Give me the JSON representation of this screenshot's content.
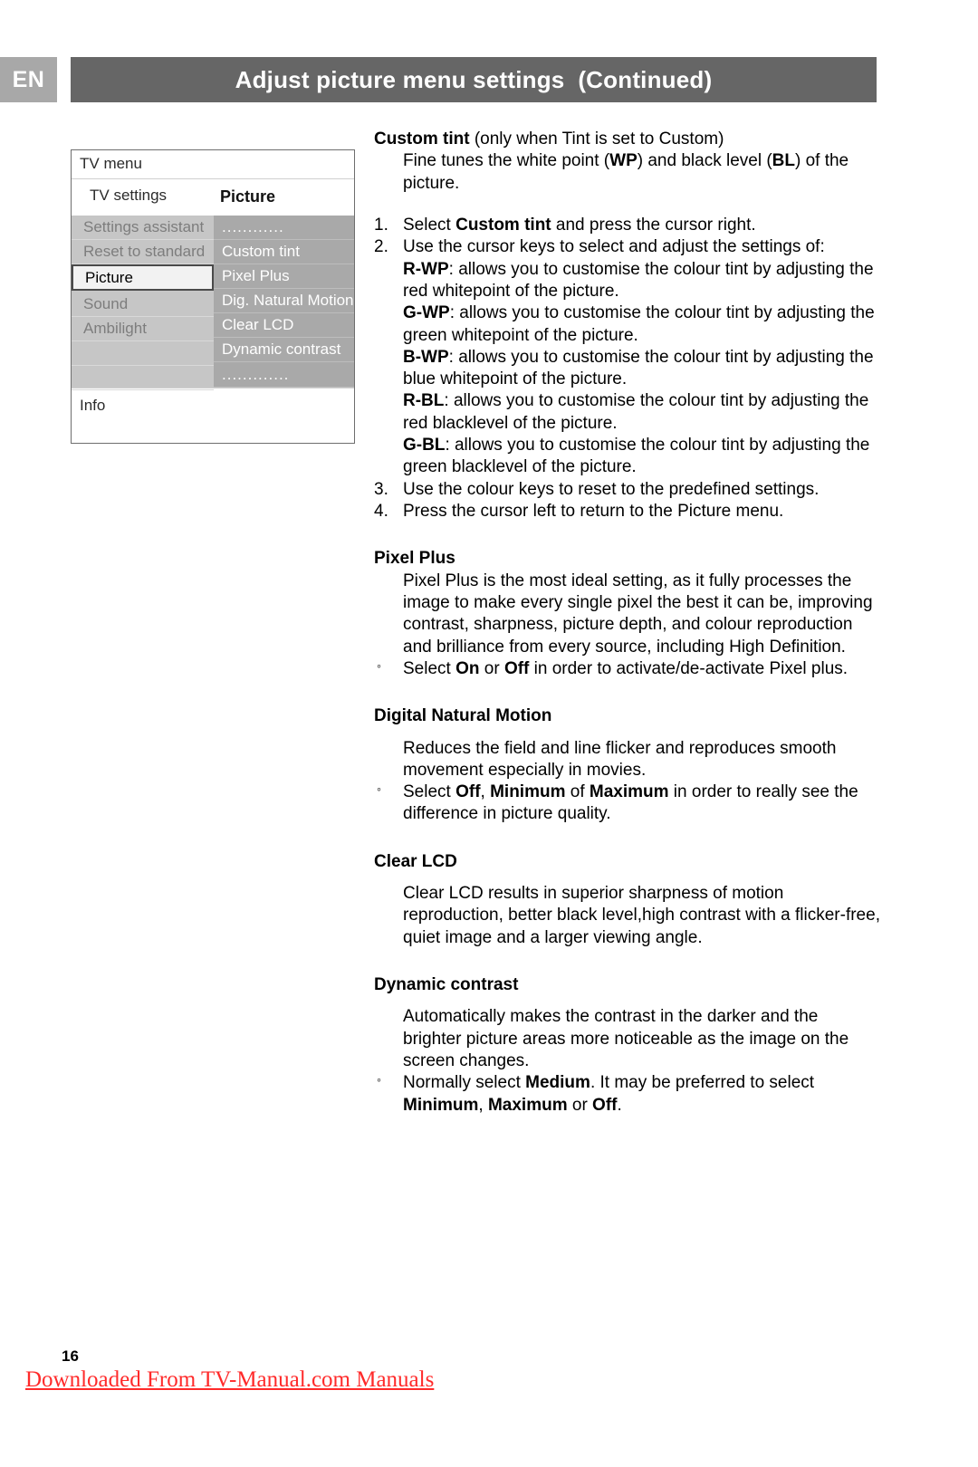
{
  "header": {
    "language_badge": "EN",
    "title": "Adjust picture menu settings  (Continued)"
  },
  "tv_menu": {
    "title": "TV menu",
    "subtitle": "TV settings",
    "column_header": "Picture",
    "left_items": [
      "Settings assistant",
      "Reset to standard",
      "Picture",
      "Sound",
      "Ambilight"
    ],
    "selected_left_item": "Picture",
    "right_items": [
      "............",
      "Custom tint",
      "Pixel Plus",
      "Dig. Natural Motion",
      "Clear LCD",
      "Dynamic contrast",
      "............."
    ],
    "info_label": "Info"
  },
  "content": {
    "custom_tint": {
      "heading_bold": "Custom tint",
      "heading_light": "  (only when Tint is set to Custom)",
      "intro_1": "Fine tunes the white point (",
      "intro_wp": "WP",
      "intro_2": ") and black level (",
      "intro_bl": "BL",
      "intro_3": ") of the picture.",
      "step1_num": "1.",
      "step1_a": "Select ",
      "step1_b": "Custom tint",
      "step1_c": " and press the cursor right.",
      "step2_num": "2.",
      "step2_text": "Use the cursor keys to select and adjust the settings of:",
      "defs": [
        {
          "term": "R-WP",
          "desc": ": allows you to customise the colour tint by adjusting the red whitepoint of the picture."
        },
        {
          "term": "G-WP",
          "desc": ": allows you to customise the colour tint by adjusting the green whitepoint of the picture."
        },
        {
          "term": "B-WP",
          "desc": ": allows you to customise the colour tint by adjusting the blue whitepoint of the picture."
        },
        {
          "term": "R-BL",
          "desc": ": allows you to customise the colour tint by adjusting the red blacklevel of the picture."
        },
        {
          "term": "G-BL",
          "desc": ": allows you to customise the colour tint by adjusting the green blacklevel of the picture."
        }
      ],
      "step3_num": "3.",
      "step3_text": "Use the colour keys to reset to the predefined settings.",
      "step4_num": "4.",
      "step4_text": "Press the cursor left to return to the Picture menu."
    },
    "pixel_plus": {
      "heading": "Pixel Plus",
      "body": "Pixel Plus is the most ideal setting, as it fully processes the image to make every single pixel the best it can be, improving contrast, sharpness, picture depth, and colour reproduction and brilliance from every source, including High Definition.",
      "bullet_a": "Select ",
      "bullet_on": "On",
      "bullet_b": " or ",
      "bullet_off": "Off",
      "bullet_c": " in order to activate/de-activate Pixel plus."
    },
    "digital_natural_motion": {
      "heading": "Digital Natural Motion",
      "body": "Reduces the field and line flicker and reproduces smooth movement especially in movies.",
      "bullet_a": "Select ",
      "bullet_off": "Off",
      "bullet_b": ", ",
      "bullet_min": "Minimum",
      "bullet_c": " of ",
      "bullet_max": "Maximum",
      "bullet_d": " in order to really see the difference in picture quality."
    },
    "clear_lcd": {
      "heading": "Clear LCD",
      "body": "Clear LCD results in superior sharpness of motion reproduction, better black level,high contrast with a flicker-free, quiet image and a larger viewing angle."
    },
    "dynamic_contrast": {
      "heading": "Dynamic contrast",
      "body": "Automatically makes the contrast in the darker and the brighter picture areas more noticeable as the image on the screen changes.",
      "bullet_a": "Normally select ",
      "bullet_medium": "Medium",
      "bullet_b": ". It may be preferred to select ",
      "bullet_min": "Minimum",
      "bullet_c": ", ",
      "bullet_max": "Maximum",
      "bullet_d": " or ",
      "bullet_off": "Off",
      "bullet_e": "."
    }
  },
  "footer": {
    "page_number": "16",
    "download_note": "Downloaded From TV-Manual.com Manuals"
  },
  "colors": {
    "header_bar": "#666666",
    "badge": "#a8a8a8",
    "menu_left": "#c6c6c6",
    "menu_right": "#a9a9a9",
    "note_red": "#ff2a2a"
  }
}
